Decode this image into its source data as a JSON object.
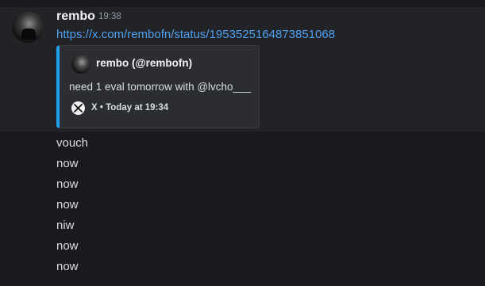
{
  "message": {
    "username": "rembo",
    "timestamp": "19:38",
    "link": "https://x.com/rembofn/status/1953525164873851068",
    "embed": {
      "author": "rembo (@rembofn)",
      "description": "need 1 eval tomorrow with @lvcho___",
      "footer_source": "X",
      "footer_separator": "•",
      "footer_time": "Today at 19:34",
      "accent_color": "#1da1f2",
      "footer_icon": "x-logo-icon"
    }
  },
  "followups": [
    "vouch",
    "now",
    "now",
    "now",
    "niw",
    "now",
    "now"
  ],
  "colors": {
    "background": "#1a1a1e",
    "message_highlight": "#222327",
    "link": "#4ea0f0",
    "embed_bg": "#2b2d31"
  }
}
